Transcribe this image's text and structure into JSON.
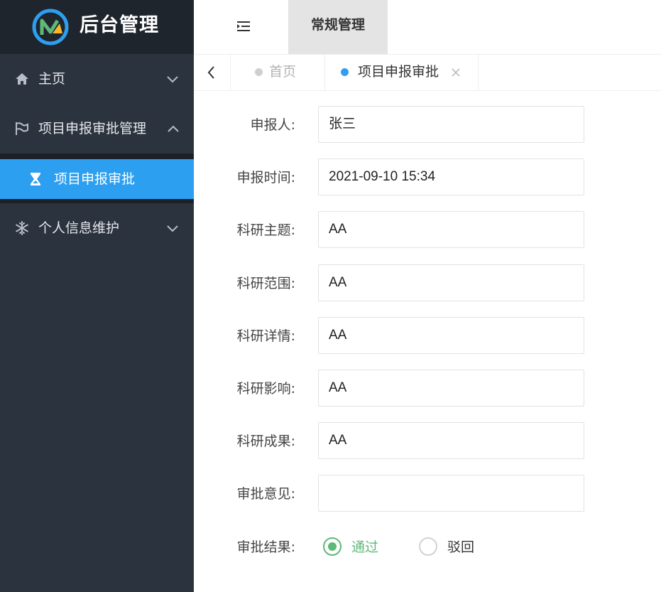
{
  "app": {
    "title": "后台管理",
    "brand_colors": {
      "logo_blue": "#2d9ff0",
      "logo_yellow": "#f5b82e",
      "logo_green": "#5fb878"
    }
  },
  "sidebar": {
    "items": [
      {
        "label": "主页",
        "icon": "home-icon",
        "expanded": false
      },
      {
        "label": "项目申报审批管理",
        "icon": "flag-icon",
        "expanded": true,
        "children": [
          {
            "label": "项目申报审批",
            "icon": "hourglass-icon",
            "active": true
          }
        ]
      },
      {
        "label": "个人信息维护",
        "icon": "snowflake-icon",
        "expanded": false
      }
    ]
  },
  "header": {
    "collapse_icon": "menu-collapse-icon",
    "nav_tab": "常规管理"
  },
  "tabs": {
    "items": [
      {
        "label": "首页",
        "active": false
      },
      {
        "label": "项目申报审批",
        "active": true,
        "closable": true
      }
    ]
  },
  "form": {
    "fields": [
      {
        "label": "申报人:",
        "value": "张三"
      },
      {
        "label": "申报时间:",
        "value": "2021-09-10 15:34"
      },
      {
        "label": "科研主题:",
        "value": "AA"
      },
      {
        "label": "科研范围:",
        "value": "AA"
      },
      {
        "label": "科研详情:",
        "value": "AA"
      },
      {
        "label": "科研影响:",
        "value": "AA"
      },
      {
        "label": "科研成果:",
        "value": "AA"
      },
      {
        "label": "审批意见:",
        "value": ""
      }
    ],
    "result": {
      "label": "审批结果:",
      "options": [
        {
          "label": "通过",
          "checked": true
        },
        {
          "label": "驳回",
          "checked": false
        }
      ]
    }
  },
  "colors": {
    "sidebar_bg": "#2a333e",
    "logo_bar_bg": "#1f252d",
    "active_blue": "#2d9ff0",
    "radio_green": "#5fb878"
  }
}
